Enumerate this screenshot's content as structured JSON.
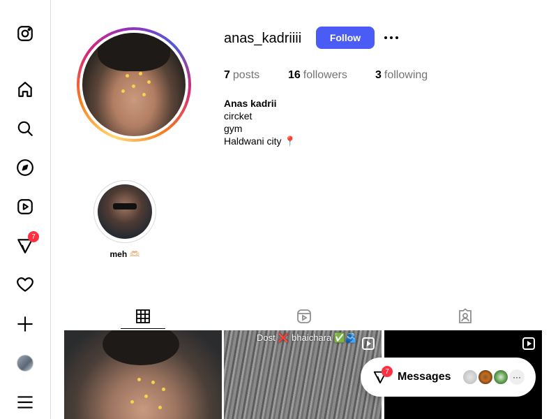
{
  "sidebar": {
    "notification_count": "7",
    "items": [
      "instagram-logo",
      "home",
      "search",
      "explore",
      "reels",
      "messages",
      "notifications",
      "create",
      "profile",
      "more"
    ]
  },
  "profile": {
    "username": "anas_kadriiii",
    "follow_label": "Follow",
    "stats": {
      "posts_count": "7",
      "posts_label": "posts",
      "followers_count": "16",
      "followers_label": "followers",
      "following_count": "3",
      "following_label": "following"
    },
    "bio": {
      "name": "Anas kadrii",
      "line1": "circket",
      "line2": "gym",
      "line3": "Haldwani city 📍"
    }
  },
  "highlights": [
    {
      "label": "meh 🫶🏻"
    }
  ],
  "tabs": [
    "posts-grid",
    "reels",
    "tagged"
  ],
  "posts": [
    {
      "caption": ""
    },
    {
      "caption": "Dost ❌ bhaichara ✅🫂"
    },
    {
      "caption": ""
    }
  ],
  "messages_bubble": {
    "label": "Messages",
    "badge": "7",
    "more": "···"
  },
  "colors": {
    "accent": "#4a5cf5",
    "badge": "#ff3040"
  }
}
